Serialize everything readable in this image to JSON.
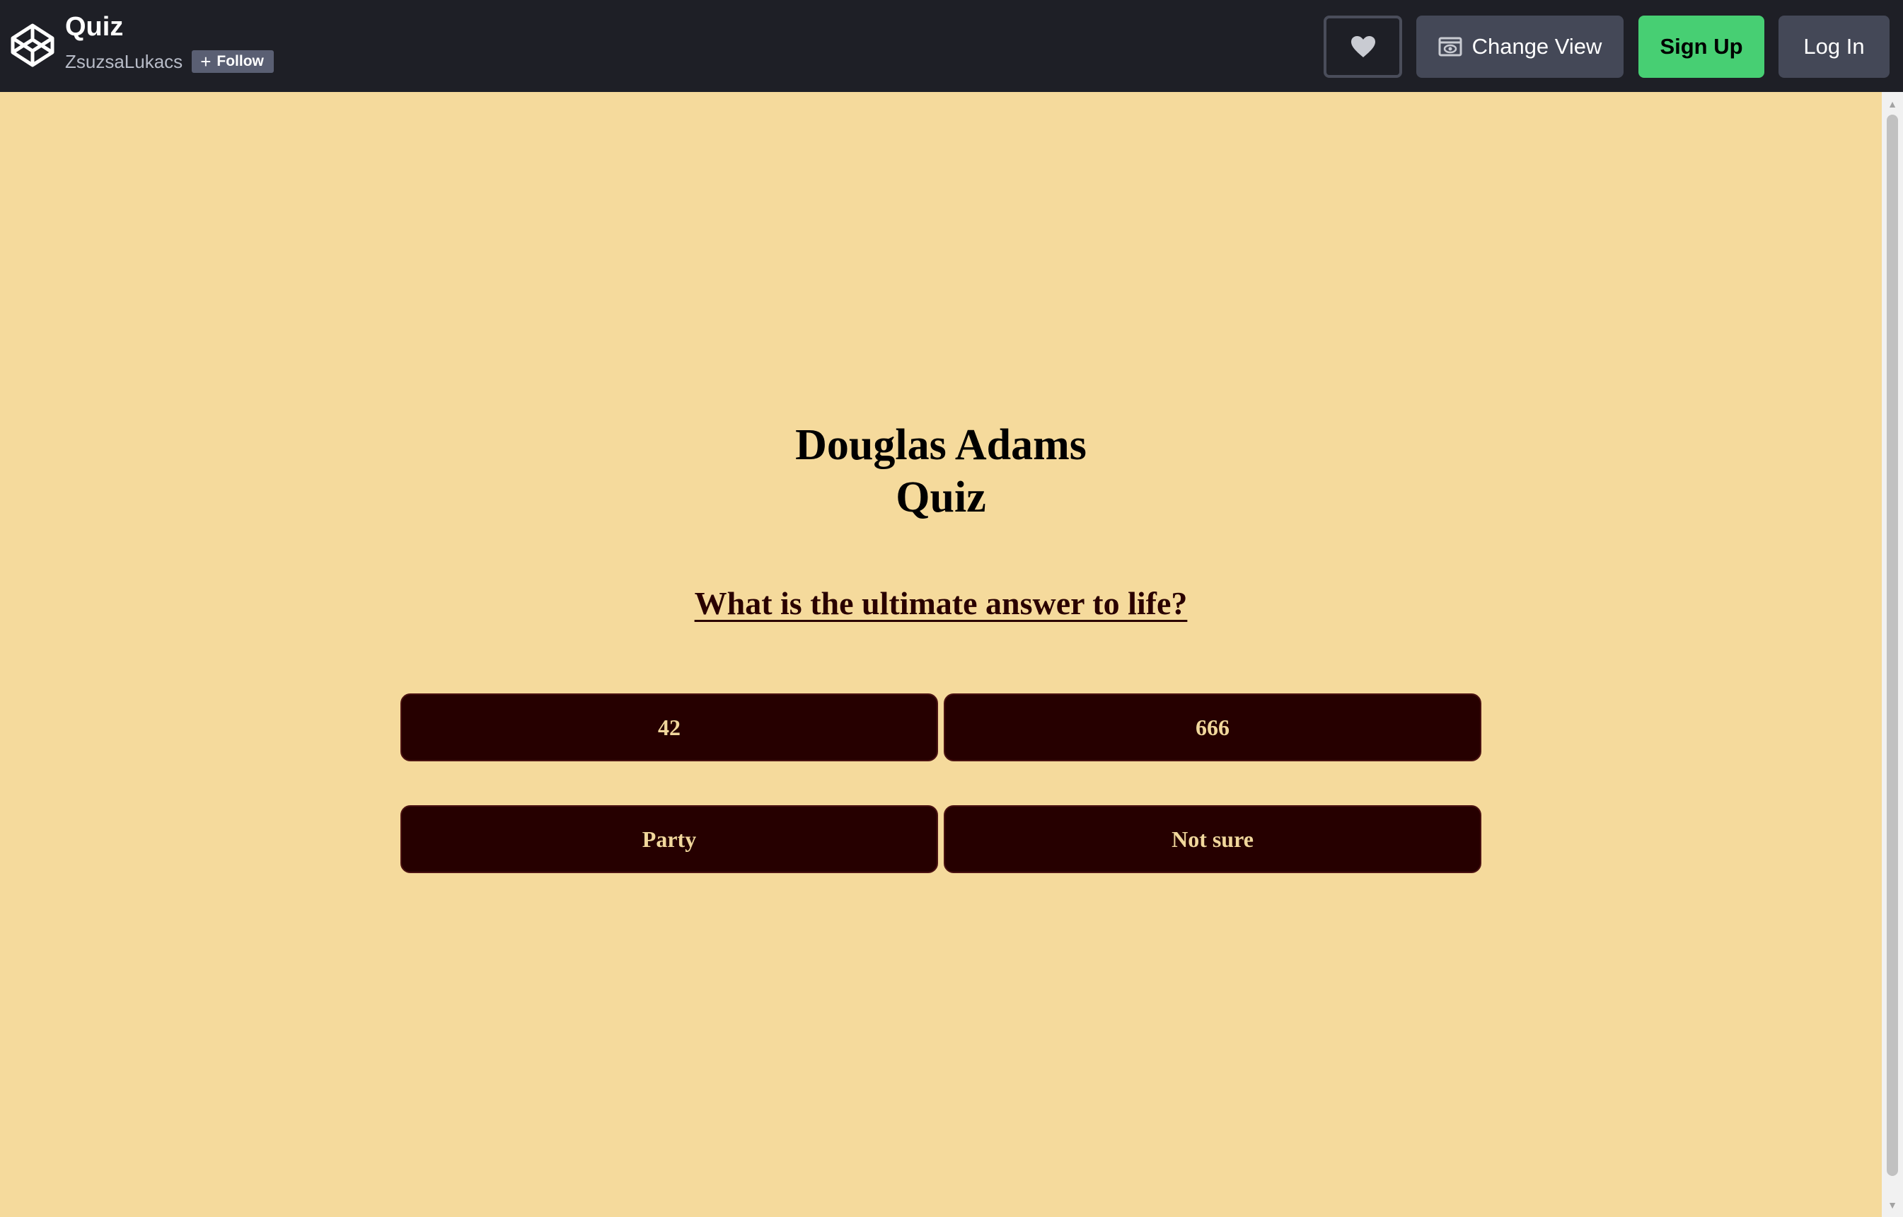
{
  "header": {
    "title": "Quiz",
    "author": "ZsuzsaLukacs",
    "follow_label": "Follow",
    "change_view_label": "Change View",
    "signup_label": "Sign Up",
    "login_label": "Log In",
    "icons": {
      "logo": "codepen-logo-icon",
      "heart": "heart-icon",
      "view": "window-eye-icon",
      "follow": "plus-icon"
    },
    "colors": {
      "bar": "#1e1f26",
      "signup": "#47cf73",
      "button": "#444857"
    }
  },
  "quiz": {
    "title_line1": "Douglas Adams",
    "title_line2": "Quiz",
    "question": "What is the ultimate answer to life?",
    "answers": [
      "42",
      "666",
      "Party",
      "Not sure"
    ],
    "colors": {
      "background": "#f5da9c",
      "answer_bg": "#260000",
      "answer_text": "#f1d79c"
    }
  }
}
